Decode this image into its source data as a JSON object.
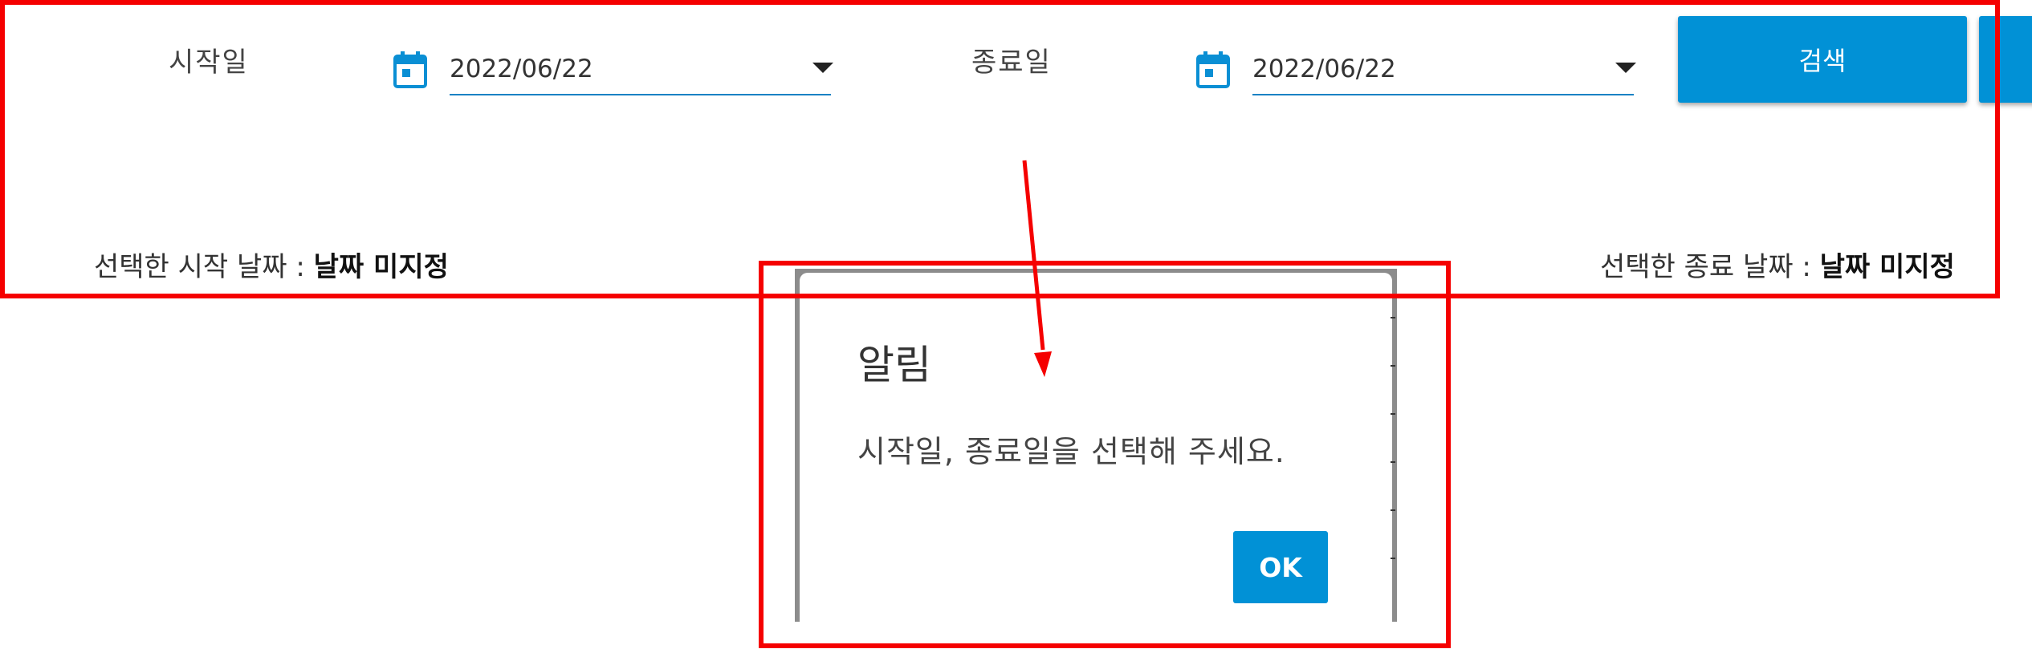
{
  "filter": {
    "start_label": "시작일",
    "start_value": "2022/06/22",
    "end_label": "종료일",
    "end_value": "2022/06/22",
    "search_label": "검색"
  },
  "selection": {
    "start_prefix": "선택한 시작 날짜 : ",
    "start_value": "날짜 미지정",
    "end_prefix": "선택한 종료 날짜 : ",
    "end_value": "날짜 미지정"
  },
  "dialog": {
    "title": "알림",
    "message": "시작일, 종료일을 선택해 주세요.",
    "ok_label": "OK"
  },
  "colors": {
    "accent": "#0191d6",
    "annotation": "#f50000",
    "icon": "#0a8fd4"
  },
  "icons": {
    "calendar": "calendar-icon",
    "dropdown": "caret-down-icon"
  }
}
